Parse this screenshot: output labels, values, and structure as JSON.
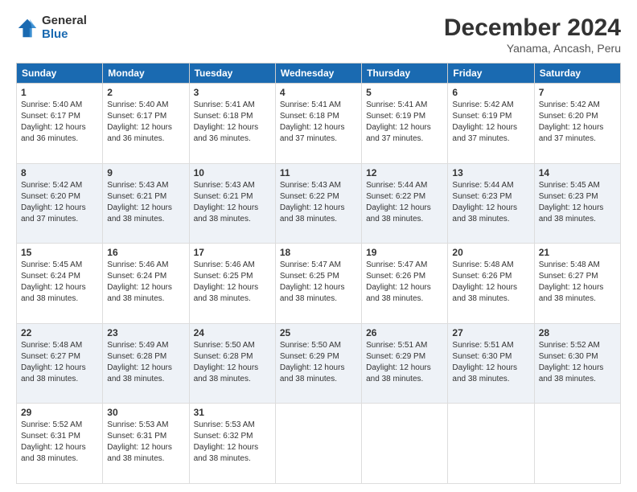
{
  "logo": {
    "general": "General",
    "blue": "Blue"
  },
  "header": {
    "title": "December 2024",
    "subtitle": "Yanama, Ancash, Peru"
  },
  "calendar": {
    "headers": [
      "Sunday",
      "Monday",
      "Tuesday",
      "Wednesday",
      "Thursday",
      "Friday",
      "Saturday"
    ],
    "weeks": [
      [
        {
          "day": "",
          "info": ""
        },
        {
          "day": "2",
          "info": "Sunrise: 5:40 AM\nSunset: 6:17 PM\nDaylight: 12 hours\nand 36 minutes."
        },
        {
          "day": "3",
          "info": "Sunrise: 5:41 AM\nSunset: 6:18 PM\nDaylight: 12 hours\nand 36 minutes."
        },
        {
          "day": "4",
          "info": "Sunrise: 5:41 AM\nSunset: 6:18 PM\nDaylight: 12 hours\nand 37 minutes."
        },
        {
          "day": "5",
          "info": "Sunrise: 5:41 AM\nSunset: 6:19 PM\nDaylight: 12 hours\nand 37 minutes."
        },
        {
          "day": "6",
          "info": "Sunrise: 5:42 AM\nSunset: 6:19 PM\nDaylight: 12 hours\nand 37 minutes."
        },
        {
          "day": "7",
          "info": "Sunrise: 5:42 AM\nSunset: 6:20 PM\nDaylight: 12 hours\nand 37 minutes."
        }
      ],
      [
        {
          "day": "1",
          "info": "Sunrise: 5:40 AM\nSunset: 6:17 PM\nDaylight: 12 hours\nand 36 minutes.",
          "first_row": true
        },
        {
          "day": "8",
          "info": "Sunrise: 5:42 AM\nSunset: 6:20 PM\nDaylight: 12 hours\nand 37 minutes."
        },
        {
          "day": "9",
          "info": "Sunrise: 5:43 AM\nSunset: 6:21 PM\nDaylight: 12 hours\nand 38 minutes."
        },
        {
          "day": "10",
          "info": "Sunrise: 5:43 AM\nSunset: 6:21 PM\nDaylight: 12 hours\nand 38 minutes."
        },
        {
          "day": "11",
          "info": "Sunrise: 5:43 AM\nSunset: 6:22 PM\nDaylight: 12 hours\nand 38 minutes."
        },
        {
          "day": "12",
          "info": "Sunrise: 5:44 AM\nSunset: 6:22 PM\nDaylight: 12 hours\nand 38 minutes."
        },
        {
          "day": "13",
          "info": "Sunrise: 5:44 AM\nSunset: 6:23 PM\nDaylight: 12 hours\nand 38 minutes."
        },
        {
          "day": "14",
          "info": "Sunrise: 5:45 AM\nSunset: 6:23 PM\nDaylight: 12 hours\nand 38 minutes."
        }
      ],
      [
        {
          "day": "15",
          "info": "Sunrise: 5:45 AM\nSunset: 6:24 PM\nDaylight: 12 hours\nand 38 minutes."
        },
        {
          "day": "16",
          "info": "Sunrise: 5:46 AM\nSunset: 6:24 PM\nDaylight: 12 hours\nand 38 minutes."
        },
        {
          "day": "17",
          "info": "Sunrise: 5:46 AM\nSunset: 6:25 PM\nDaylight: 12 hours\nand 38 minutes."
        },
        {
          "day": "18",
          "info": "Sunrise: 5:47 AM\nSunset: 6:25 PM\nDaylight: 12 hours\nand 38 minutes."
        },
        {
          "day": "19",
          "info": "Sunrise: 5:47 AM\nSunset: 6:26 PM\nDaylight: 12 hours\nand 38 minutes."
        },
        {
          "day": "20",
          "info": "Sunrise: 5:48 AM\nSunset: 6:26 PM\nDaylight: 12 hours\nand 38 minutes."
        },
        {
          "day": "21",
          "info": "Sunrise: 5:48 AM\nSunset: 6:27 PM\nDaylight: 12 hours\nand 38 minutes."
        }
      ],
      [
        {
          "day": "22",
          "info": "Sunrise: 5:48 AM\nSunset: 6:27 PM\nDaylight: 12 hours\nand 38 minutes."
        },
        {
          "day": "23",
          "info": "Sunrise: 5:49 AM\nSunset: 6:28 PM\nDaylight: 12 hours\nand 38 minutes."
        },
        {
          "day": "24",
          "info": "Sunrise: 5:50 AM\nSunset: 6:28 PM\nDaylight: 12 hours\nand 38 minutes."
        },
        {
          "day": "25",
          "info": "Sunrise: 5:50 AM\nSunset: 6:29 PM\nDaylight: 12 hours\nand 38 minutes."
        },
        {
          "day": "26",
          "info": "Sunrise: 5:51 AM\nSunset: 6:29 PM\nDaylight: 12 hours\nand 38 minutes."
        },
        {
          "day": "27",
          "info": "Sunrise: 5:51 AM\nSunset: 6:30 PM\nDaylight: 12 hours\nand 38 minutes."
        },
        {
          "day": "28",
          "info": "Sunrise: 5:52 AM\nSunset: 6:30 PM\nDaylight: 12 hours\nand 38 minutes."
        }
      ],
      [
        {
          "day": "29",
          "info": "Sunrise: 5:52 AM\nSunset: 6:31 PM\nDaylight: 12 hours\nand 38 minutes."
        },
        {
          "day": "30",
          "info": "Sunrise: 5:53 AM\nSunset: 6:31 PM\nDaylight: 12 hours\nand 38 minutes."
        },
        {
          "day": "31",
          "info": "Sunrise: 5:53 AM\nSunset: 6:32 PM\nDaylight: 12 hours\nand 38 minutes."
        },
        {
          "day": "",
          "info": ""
        },
        {
          "day": "",
          "info": ""
        },
        {
          "day": "",
          "info": ""
        },
        {
          "day": "",
          "info": ""
        }
      ]
    ]
  }
}
